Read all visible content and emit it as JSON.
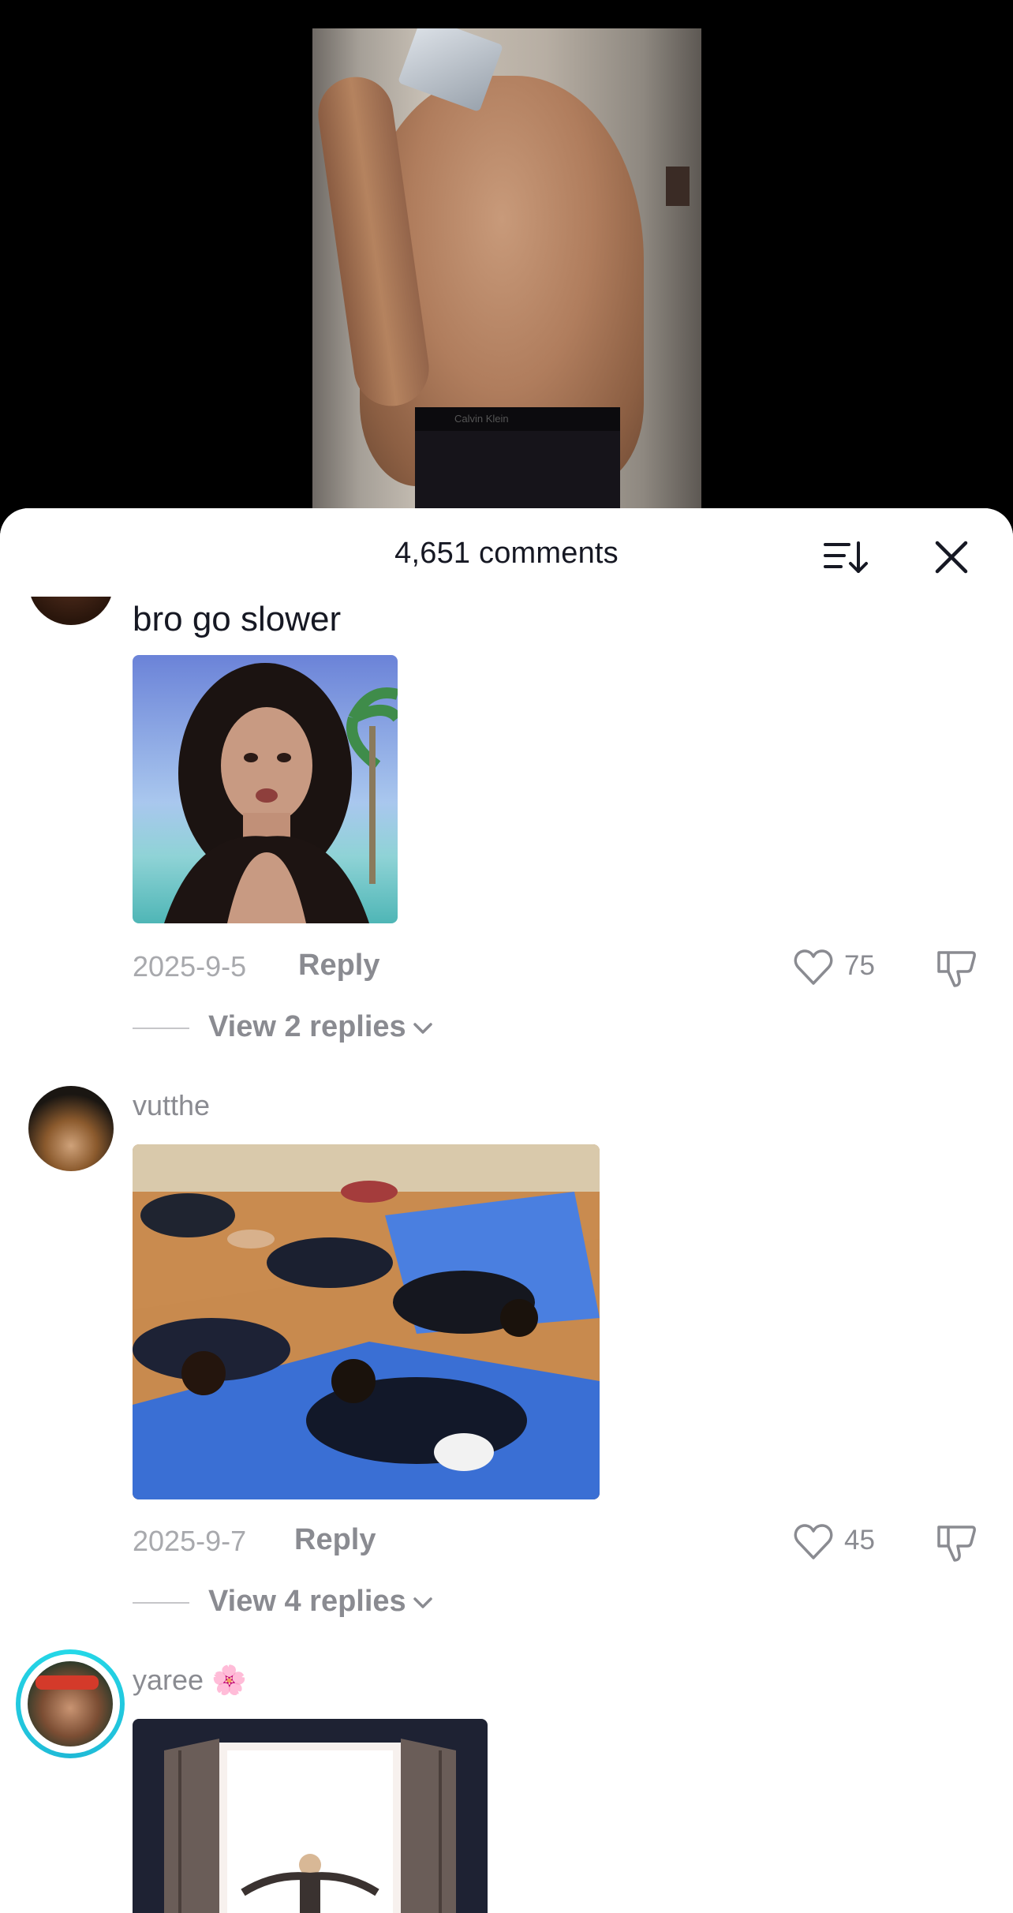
{
  "video": {
    "waistband_text": "Calvin Klein"
  },
  "sheet": {
    "title": "4,651 comments",
    "sort_icon": "sort-lines-down-icon",
    "close_icon": "close-x-icon"
  },
  "comments": [
    {
      "username": "",
      "text": "bro go slower",
      "image": "woman-beach-portrait",
      "date": "2025-9-5",
      "reply_label": "Reply",
      "likes": "75",
      "replies_label": "View 2 replies"
    },
    {
      "username": "vutthe",
      "text": "",
      "image": "group-floor-exercise",
      "date": "2025-9-7",
      "reply_label": "Reply",
      "likes": "45",
      "replies_label": "View 4 replies"
    },
    {
      "username": "yaree 🌸",
      "text": "",
      "image": "doorway-light-figure",
      "avatar_ring_color": "#25d9e8"
    }
  ],
  "colors": {
    "primary_text": "#161823",
    "secondary_text": "#8a8b91",
    "accent_ring": "#25d9e8"
  }
}
